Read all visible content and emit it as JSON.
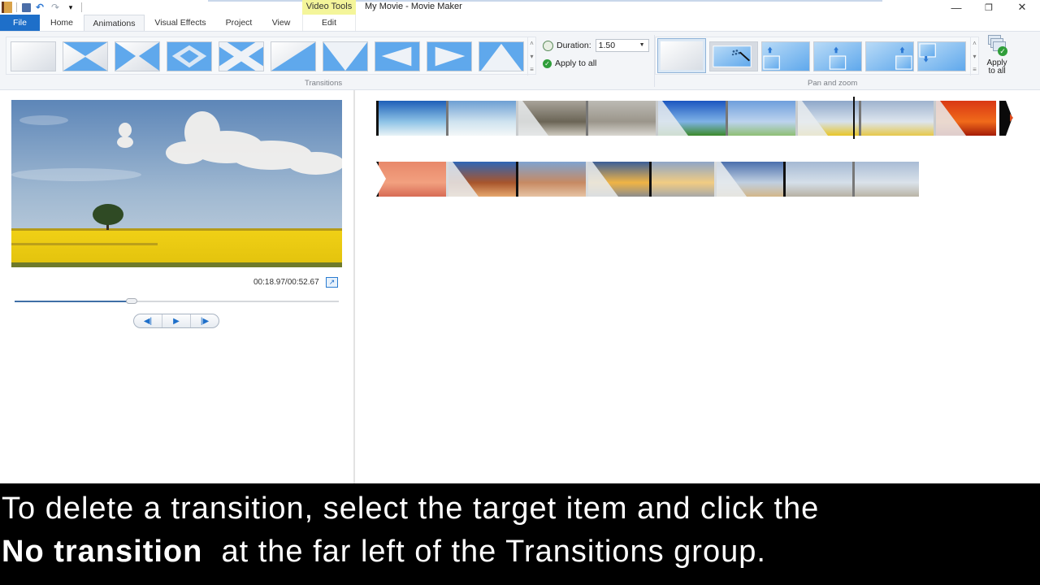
{
  "window": {
    "title": "My Movie - Movie Maker",
    "contextual_tab_group": "Video Tools",
    "controls": {
      "minimize": "—",
      "restore": "❐",
      "close": "✕"
    }
  },
  "quick_access": {
    "app_icon": "film-icon",
    "items": [
      {
        "name": "save-icon",
        "glyph": "▪"
      },
      {
        "name": "undo-icon",
        "glyph": "↶"
      },
      {
        "name": "redo-icon",
        "glyph": "↷"
      },
      {
        "name": "customize-qat-icon",
        "glyph": "▾"
      }
    ]
  },
  "tabs": [
    {
      "id": "file",
      "label": "File"
    },
    {
      "id": "home",
      "label": "Home"
    },
    {
      "id": "animations",
      "label": "Animations",
      "active": true
    },
    {
      "id": "visual-effects",
      "label": "Visual Effects"
    },
    {
      "id": "project",
      "label": "Project"
    },
    {
      "id": "view",
      "label": "View"
    },
    {
      "id": "edit",
      "label": "Edit"
    }
  ],
  "help": {
    "collapse_glyph": "^",
    "help_glyph": "?"
  },
  "ribbon": {
    "transitions": {
      "group_label": "Transitions",
      "items": [
        {
          "name": "no-transition",
          "pattern": "none"
        },
        {
          "name": "bowtie-horizontal",
          "pattern": "bowtie-h"
        },
        {
          "name": "bowtie-vertical",
          "pattern": "bowtie-v"
        },
        {
          "name": "diamond",
          "pattern": "diamond"
        },
        {
          "name": "cross",
          "pattern": "cross"
        },
        {
          "name": "diagonal-up",
          "pattern": "diag"
        },
        {
          "name": "v-down",
          "pattern": "v-down"
        },
        {
          "name": "arrow-left",
          "pattern": "arrow-left"
        },
        {
          "name": "arrow-right",
          "pattern": "arrow-right"
        },
        {
          "name": "v-up",
          "pattern": "v-up"
        }
      ],
      "duration_label": "Duration:",
      "duration_value": "1.50",
      "apply_to_all": "Apply to all"
    },
    "pan_zoom": {
      "group_label": "Pan and zoom",
      "items": [
        {
          "name": "no-pan-zoom",
          "selected": true
        },
        {
          "name": "automatic"
        },
        {
          "name": "pan-up-left"
        },
        {
          "name": "pan-up-center"
        },
        {
          "name": "pan-up-right"
        },
        {
          "name": "pan-down-left"
        }
      ],
      "apply_to_all_line1": "Apply",
      "apply_to_all_line2": "to all"
    }
  },
  "preview": {
    "timecode": "00:18.97/00:52.67",
    "progress_fraction": 0.36,
    "transport": {
      "previous_frame": "◀|",
      "play": "▶",
      "next_frame": "|▶"
    }
  },
  "storyboard": {
    "row1": [
      {
        "scene": "beach-rock",
        "colors": [
          "#1d5fb8",
          "#8ec3e6",
          "#e9f3f6"
        ],
        "transition": false
      },
      {
        "scene": "beach-rock-faded",
        "colors": [
          "#6d9fd3",
          "#cfe3ef",
          "#f3f7f8"
        ],
        "transition": false
      },
      {
        "scene": "mountain-fog",
        "colors": [
          "#a8a39a",
          "#6b6556",
          "#cfcbc0"
        ],
        "transition": true
      },
      {
        "scene": "mountain-fog-faded",
        "colors": [
          "#bcbab4",
          "#9b968b",
          "#d9d7d1"
        ],
        "transition": false
      },
      {
        "scene": "green-field",
        "colors": [
          "#1a55c0",
          "#7fb2e6",
          "#3d8b2b"
        ],
        "transition": true
      },
      {
        "scene": "green-field-faded",
        "colors": [
          "#6f9fdc",
          "#bcd3ee",
          "#8fbf74"
        ],
        "transition": false
      },
      {
        "scene": "yellow-field",
        "colors": [
          "#8ea7c9",
          "#d6e1ec",
          "#e8c628"
        ],
        "transition": true,
        "selected": true
      },
      {
        "scene": "yellow-field-faded",
        "colors": [
          "#9fb3ce",
          "#dde5ee",
          "#e6c84a"
        ],
        "transition": false,
        "selected": true
      },
      {
        "scene": "red-flower",
        "colors": [
          "#d93814",
          "#f06a1a",
          "#a51c08"
        ],
        "transition": true
      }
    ],
    "row2": [
      {
        "scene": "red-flower-faded",
        "colors": [
          "#e8886a",
          "#f2a07f",
          "#d76b55"
        ],
        "transition": false
      },
      {
        "scene": "desert-butte",
        "colors": [
          "#2e66b6",
          "#a8552c",
          "#e6a76e"
        ],
        "transition": true
      },
      {
        "scene": "desert-butte-faded",
        "colors": [
          "#7fa3d0",
          "#c78a63",
          "#e6c3a3"
        ],
        "transition": false
      },
      {
        "scene": "sunset-harbor",
        "colors": [
          "#3b5e98",
          "#f0b445",
          "#8c8c8c"
        ],
        "transition": true
      },
      {
        "scene": "sunset-harbor-faded",
        "colors": [
          "#8ea5c7",
          "#f1cc82",
          "#a8a8a8"
        ],
        "transition": false
      },
      {
        "scene": "sea-shore",
        "colors": [
          "#4a6fad",
          "#c0cfe0",
          "#d3b789"
        ],
        "transition": true
      },
      {
        "scene": "sea-shore-2",
        "colors": [
          "#a5b9d3",
          "#d5dfe9",
          "#b7b1a4"
        ],
        "transition": false
      },
      {
        "scene": "sea-shore-3",
        "colors": [
          "#a9bcd5",
          "#dae2ea",
          "#bab4a6"
        ],
        "transition": false
      }
    ]
  },
  "caption": {
    "line1": "To delete a transition, select the target item and click the",
    "line2_bold": "No transition",
    "line2_rest": "  at the far left of the Transitions group."
  }
}
